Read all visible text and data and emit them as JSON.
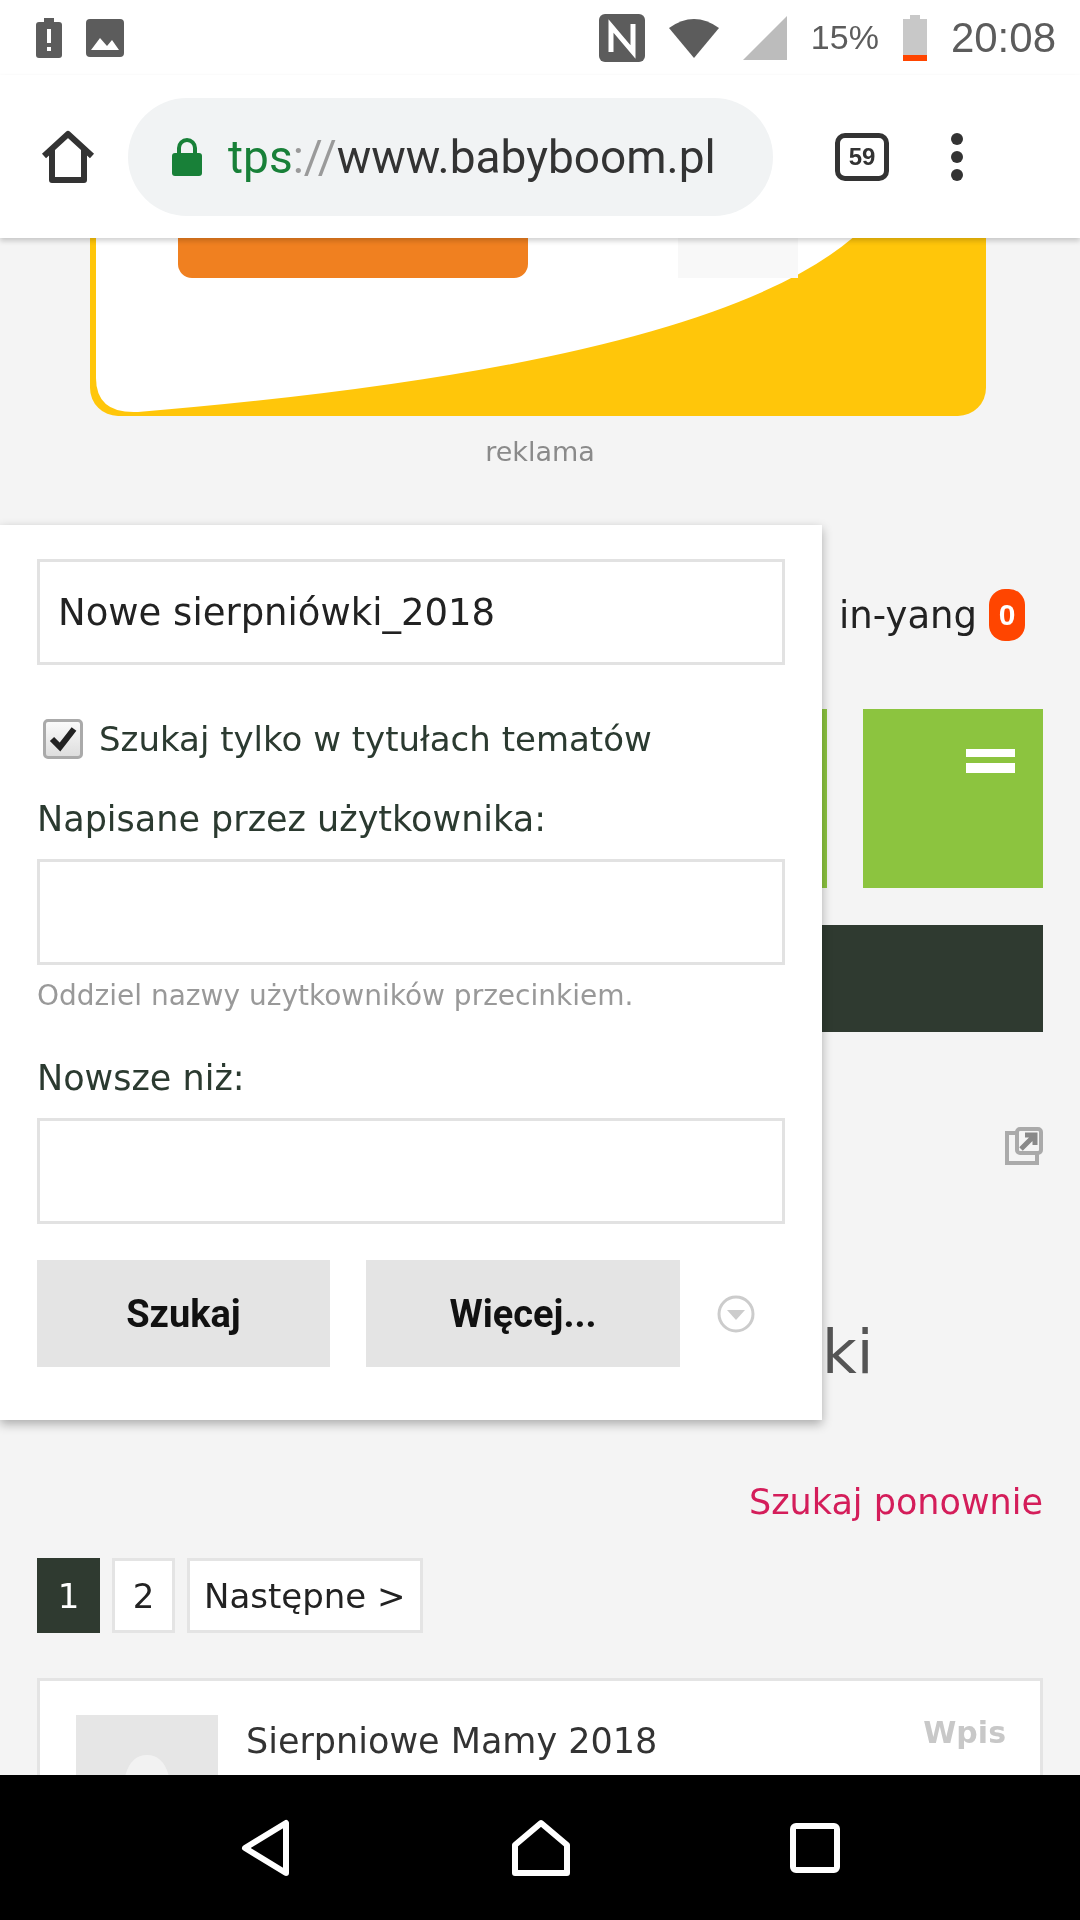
{
  "status_bar": {
    "battery_percent": "15%",
    "time": "20:08"
  },
  "browser": {
    "url": {
      "scheme": "tps",
      "separator": "://",
      "host": "www.babyboom.pl"
    },
    "tab_count": "59"
  },
  "ad": {
    "kind": "picture",
    "label": "reklama"
  },
  "background": {
    "user_name": "in-yang",
    "notification_count": "0",
    "heading_fragment": "ki"
  },
  "search_popup": {
    "query": "Nowe sierpniówki_2018",
    "titles_only": {
      "label": "Szukaj tylko w tytułach tematów",
      "checked": true
    },
    "author_label": "Napisane przez użytkownika:",
    "author_hint": "Oddziel nazwy użytkowników przecinkiem.",
    "newer_label": "Nowsze niż:",
    "buttons": [
      "Szukaj",
      "Więcej..."
    ]
  },
  "search_again": "Szukaj ponownie",
  "pagination": [
    {
      "label": "1",
      "selected": true
    },
    {
      "label": "2",
      "selected": false
    },
    {
      "label": "Następne >",
      "selected": false
    }
  ],
  "results": [
    {
      "title": "Sierpniowe Mamy 2018",
      "type": "Wpis"
    }
  ]
}
